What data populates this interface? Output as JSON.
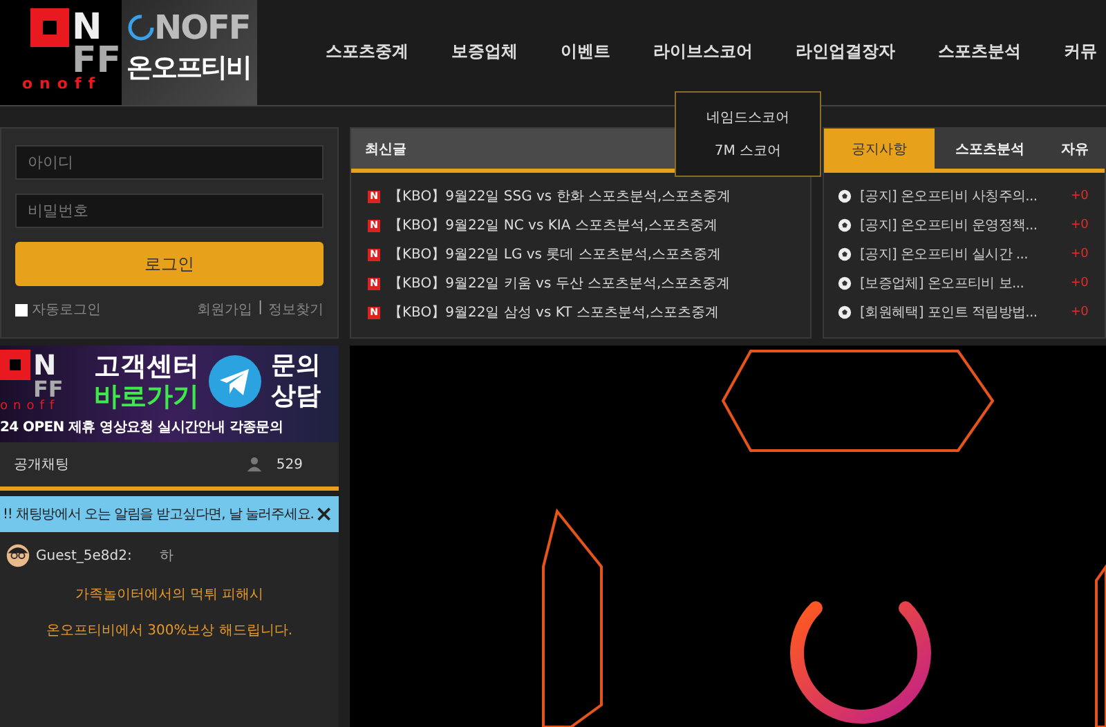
{
  "brand": {
    "mark_top": "N",
    "mark_bottom": "FF",
    "mark_caption": "onoff",
    "wordmark": "NOFF",
    "name": "온오프티비"
  },
  "nav": [
    {
      "label": "스포츠중계"
    },
    {
      "label": "보증업체"
    },
    {
      "label": "이벤트"
    },
    {
      "label": "라이브스코어"
    },
    {
      "label": "라인업결장자"
    },
    {
      "label": "스포츠분석"
    },
    {
      "label": "커뮤"
    }
  ],
  "dropdown": {
    "items": [
      "네임드스코어",
      "7M 스코어"
    ]
  },
  "login": {
    "id_placeholder": "아이디",
    "password_placeholder": "비밀번호",
    "button": "로그인",
    "remember": {
      "label": "자동로그인",
      "checked": false
    },
    "links": [
      "회원가입",
      "정보찾기"
    ],
    "separator": "|"
  },
  "latest": {
    "title": "최신글",
    "posts": [
      {
        "badge": "N",
        "title": "【KBO】9월22일 SSG vs 한화 스포츠분석,스포츠중계"
      },
      {
        "badge": "N",
        "title": "【KBO】9월22일 NC vs KIA 스포츠분석,스포츠중계"
      },
      {
        "badge": "N",
        "title": "【KBO】9월22일 LG vs 롯데 스포츠분석,스포츠중계"
      },
      {
        "badge": "N",
        "title": "【KBO】9월22일 키움 vs 두산 스포츠분석,스포츠중계"
      },
      {
        "badge": "N",
        "title": "【KBO】9월22일 삼성 vs KT 스포츠분석,스포츠중계"
      }
    ]
  },
  "board": {
    "tabs": [
      {
        "label": "공지사항",
        "selected": true
      },
      {
        "label": "스포츠분석",
        "selected": false
      },
      {
        "label": "자유",
        "selected": false
      }
    ],
    "items": [
      {
        "title": "[공지] 온오프티비 사칭주의...",
        "count": "+0"
      },
      {
        "title": "[공지] 온오프티비 운영정책...",
        "count": "+0"
      },
      {
        "title": "[공지] 온오프티비 실시간 ...",
        "count": "+0"
      },
      {
        "title": "[보증업체] 온오프티비 보...",
        "count": "+0"
      },
      {
        "title": "[회원혜택] 포인트 적립방법...",
        "count": "+0"
      }
    ]
  },
  "banner": {
    "mark_top": "N",
    "mark_bottom": "FF",
    "mark_caption": "onoff",
    "line1": "고객센터",
    "line2": "바로가기",
    "side1": "문의",
    "side2": "상담",
    "ticker": "24 OPEN 제휴 영상요청 실시간안내 각종문의"
  },
  "chat": {
    "title": "공개채팅",
    "users": "529",
    "notice": "!! 채팅방에서 오는 알림을 받고싶다면, 날 눌러주세요.",
    "close": "×",
    "messages": [
      {
        "kind": "user",
        "name": "Guest_5e8d2:",
        "text": "하"
      },
      {
        "kind": "system",
        "text": "가족놀이터에서의 먹튀 피해시"
      },
      {
        "kind": "system",
        "text": "온오프티비에서 300%보상 해드립니다."
      }
    ]
  }
}
